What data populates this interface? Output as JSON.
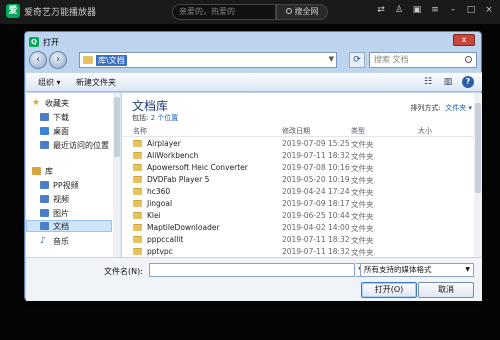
{
  "player": {
    "title": "爱奇艺万能播放器",
    "search_placeholder": "亲爱的，热爱的",
    "search_button": "搜全网"
  },
  "dialog": {
    "title": "打开",
    "close_label": "x",
    "address": "库\\文档",
    "search_placeholder": "搜索 文档",
    "toolbar": {
      "organize": "组织 ▾",
      "new_folder": "新建文件夹"
    },
    "nav": {
      "favorites": "收藏夹",
      "downloads": "下载",
      "desktop": "桌面",
      "recent": "最近访问的位置",
      "libraries": "库",
      "pp_video": "PP视频",
      "video": "视频",
      "pictures": "图片",
      "documents": "文档",
      "music": "音乐"
    },
    "library": {
      "title": "文档库",
      "includes_label": "包括:",
      "includes_value": "2 个位置",
      "arrange_label": "排列方式:",
      "arrange_value": "文件夹 ▾"
    },
    "columns": {
      "name": "名称",
      "date": "修改日期",
      "type": "类型",
      "size": "大小"
    },
    "files": [
      {
        "name": "Airplayer",
        "date": "2019-07-09 15:25",
        "type": "文件夹"
      },
      {
        "name": "AliWorkbench",
        "date": "2019-07-11 18:32",
        "type": "文件夹"
      },
      {
        "name": "Apowersoft Heic Converter",
        "date": "2019-07-08 10:16",
        "type": "文件夹"
      },
      {
        "name": "DVDFab Player 5",
        "date": "2019-05-20 10:19",
        "type": "文件夹"
      },
      {
        "name": "hc360",
        "date": "2019-04-24 17:24",
        "type": "文件夹"
      },
      {
        "name": "Jingoal",
        "date": "2019-07-09 18:17",
        "type": "文件夹"
      },
      {
        "name": "Klei",
        "date": "2019-06-25 10:44",
        "type": "文件夹"
      },
      {
        "name": "MaptileDownloader",
        "date": "2019-04-02 14:00",
        "type": "文件夹"
      },
      {
        "name": "pppccallit",
        "date": "2019-07-11 18:32",
        "type": "文件夹"
      },
      {
        "name": "pptvpc",
        "date": "2019-07-11 18:32",
        "type": "文件夹"
      }
    ],
    "filename_label": "文件名(N):",
    "filename_value": "",
    "filetype_value": "所有支持的媒体格式",
    "open_button": "打开(O)",
    "cancel_button": "取消"
  }
}
